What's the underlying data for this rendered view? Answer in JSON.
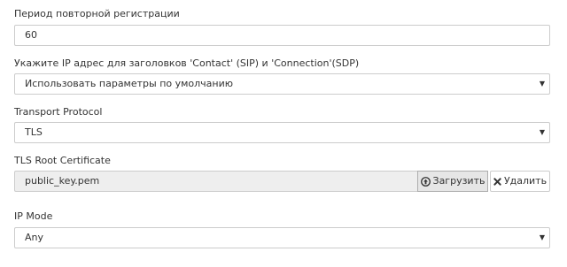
{
  "retry_period": {
    "label": "Период повторной регистрации",
    "value": "60"
  },
  "ip_address": {
    "label": "Укажите IP адрес для заголовков 'Contact' (SIP) и 'Connection'(SDP)",
    "selected": "Использовать параметры по умолчанию"
  },
  "transport_protocol": {
    "label": "Transport Protocol",
    "selected": "TLS"
  },
  "tls_root_certificate": {
    "label": "TLS Root Certificate",
    "filename": "public_key.pem",
    "upload_label": "Загрузить",
    "delete_label": "Удалить"
  },
  "ip_mode": {
    "label": "IP Mode",
    "selected": "Any"
  },
  "icons": {
    "caret": "caret-down-icon",
    "upload": "upload-circle-icon",
    "delete": "close-icon"
  }
}
